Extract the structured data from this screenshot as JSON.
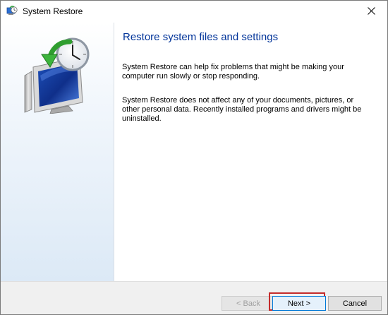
{
  "window": {
    "title": "System Restore",
    "icon": "system-restore-icon",
    "close_icon": "close-icon"
  },
  "side_panel": {
    "illustration": "system-restore-monitor-clock-icon"
  },
  "main": {
    "heading": "Restore system files and settings",
    "paragraph1": "System Restore can help fix problems that might be making your computer run slowly or stop responding.",
    "paragraph2": "System Restore does not affect any of your documents, pictures, or other personal data. Recently installed programs and drivers might be uninstalled."
  },
  "footer": {
    "back_label": "< Back",
    "next_label": "Next >",
    "cancel_label": "Cancel"
  },
  "colors": {
    "heading": "#003399",
    "highlight": "#c42b2b",
    "default_button_border": "#0078d7"
  }
}
